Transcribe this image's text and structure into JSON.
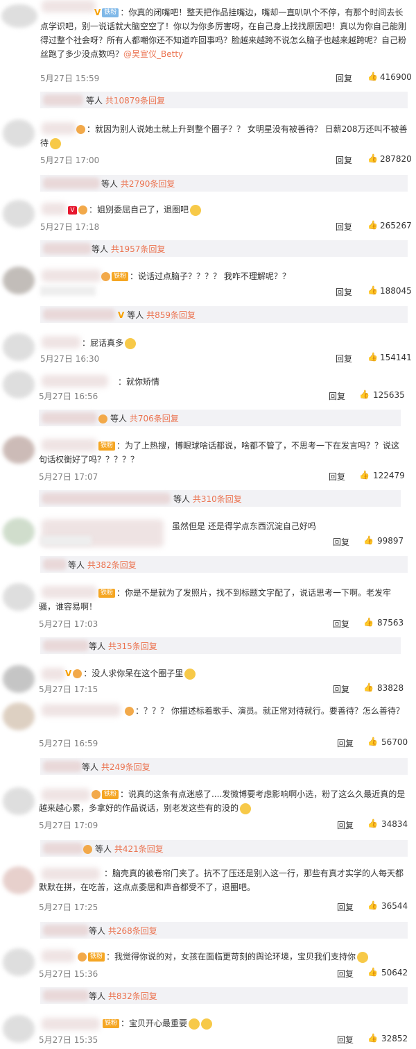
{
  "labels": {
    "reply": "回复",
    "people_suffix": "等人",
    "like_icon": "thumbs-up-icon"
  },
  "comments": [
    {
      "text": "：你真的闭嘴吧！整天把作品挂嘴边，嘴却一直叭叭个不停，有那个时间去长点学识吧，别一说话就大脑空空了！你以为你多厉害呀，在自己身上找找原因吧！真以为你自己能刚得过整个社会呀？所有人都嘲你还不知道咋回事吗？脸越来越跨不说怎么脑子也越来越跨呢？自己粉丝跑了多少没点数吗？",
      "mention": "@吴宣仪_Betty",
      "badge": "铁粉",
      "time": "5月27日 15:59",
      "likes": "416900"
    },
    {
      "text": "：就因为别人说她土就上升到整个圈子？？ 女明星没有被善待？ 日薪208万还叫不被善待",
      "time": "5月27日 17:00",
      "likes": "287820"
    },
    {
      "text": "：姐别委屈自己了，退圈吧",
      "time": "5月27日 17:18",
      "likes": "265267"
    },
    {
      "text": "：说话过点脑子？？？？ 我咋不理解呢？？",
      "badge": "铁粉",
      "time": "",
      "likes": "188045"
    },
    {
      "text": "：屁话真多",
      "time": "5月27日 16:30",
      "likes": "154141"
    },
    {
      "text": "：就你矫情",
      "time": "5月27日 16:56",
      "likes": "125635"
    },
    {
      "text": "：为了上热搜，博眼球啥话都说，啥都不管了，不思考一下在发言吗？？说这句话权衡好了吗？？？？？",
      "badge": "铁粉",
      "time": "5月27日 17:07",
      "likes": "122479"
    },
    {
      "text": "虽然但是 还是得学点东西沉淀自己好吗",
      "time": "",
      "likes": "99897"
    },
    {
      "text": "：你是不是就为了发照片，找不到标题文字配了，说话思考一下啊。老发牢骚，谁容易啊！",
      "badge": "铁粉",
      "time": "5月27日 17:03",
      "likes": "87563"
    },
    {
      "text": "：没人求你呆在这个圈子里",
      "time": "5月27日 17:15",
      "likes": "83828"
    },
    {
      "text": "：？？？ 你描述标着歌手、演员。就正常对待就行。要善待？怎么善待？",
      "time": "5月27日 16:59",
      "likes": "56700"
    },
    {
      "text": "：说真的这条有点迷惑了....发微博要考虑影响啊小选，粉了这么久最近真的是越来越心累，多拿好的作品说话，别老发这些有的没的",
      "badge": "铁粉",
      "time": "5月27日 17:09",
      "likes": "34834"
    },
    {
      "text": "：脑壳真的被卷帘门夹了。抗不了压还是别入这一行，那些有真才实学的人每天都默默在拼，在吃苦，这点点委屈和声音都受不了，退圈吧。",
      "time": "5月27日 17:25",
      "likes": "36544"
    },
    {
      "text": "：我觉得你说的对，女孩在面临更苛刻的舆论环境，宝贝我们支持你",
      "badge": "铁粉",
      "time": "5月27日 15:36",
      "likes": "50642"
    },
    {
      "text": "：宝贝开心最重要",
      "badge": "铁粉",
      "time": "5月27日 15:35",
      "likes": "32852"
    }
  ],
  "subreplies": [
    {
      "count": "共10879条回复"
    },
    {
      "count": "共2790条回复"
    },
    {
      "count": "共1957条回复"
    },
    {
      "count": "共859条回复"
    },
    {
      "count": "共706条回复"
    },
    {
      "count": "共310条回复"
    },
    {
      "count": "共382条回复"
    },
    {
      "count": "共315条回复"
    },
    {
      "count": "共249条回复"
    },
    {
      "count": "共421条回复"
    },
    {
      "count": "共268条回复"
    },
    {
      "count": "共832条回复"
    }
  ]
}
